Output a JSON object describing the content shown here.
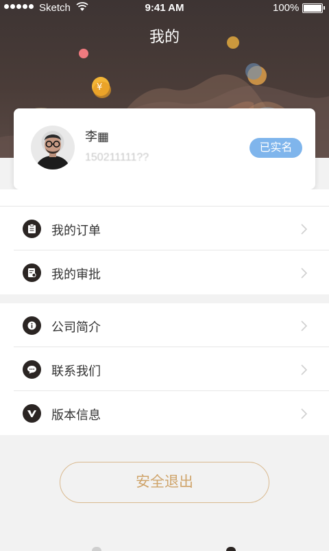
{
  "status_bar": {
    "carrier": "Sketch",
    "time": "9:41 AM",
    "battery": "100%"
  },
  "header": {
    "title": "我的"
  },
  "profile": {
    "name": "李▦",
    "phone": "150211111??",
    "badge": "已实名"
  },
  "menu_group_1": [
    {
      "label": "我的订单",
      "icon": "clipboard-icon"
    },
    {
      "label": "我的审批",
      "icon": "approval-doc-icon"
    }
  ],
  "menu_group_2": [
    {
      "label": "公司简介",
      "icon": "info-icon"
    },
    {
      "label": "联系我们",
      "icon": "chat-bubble-icon"
    },
    {
      "label": "版本信息",
      "icon": "version-v-icon"
    }
  ],
  "logout": {
    "label": "安全退出"
  },
  "colors": {
    "header_bg": "#3d3433",
    "badge_bg": "#7fb5ec",
    "icon_bg": "#2b2523",
    "logout_accent": "#cfa46b"
  }
}
